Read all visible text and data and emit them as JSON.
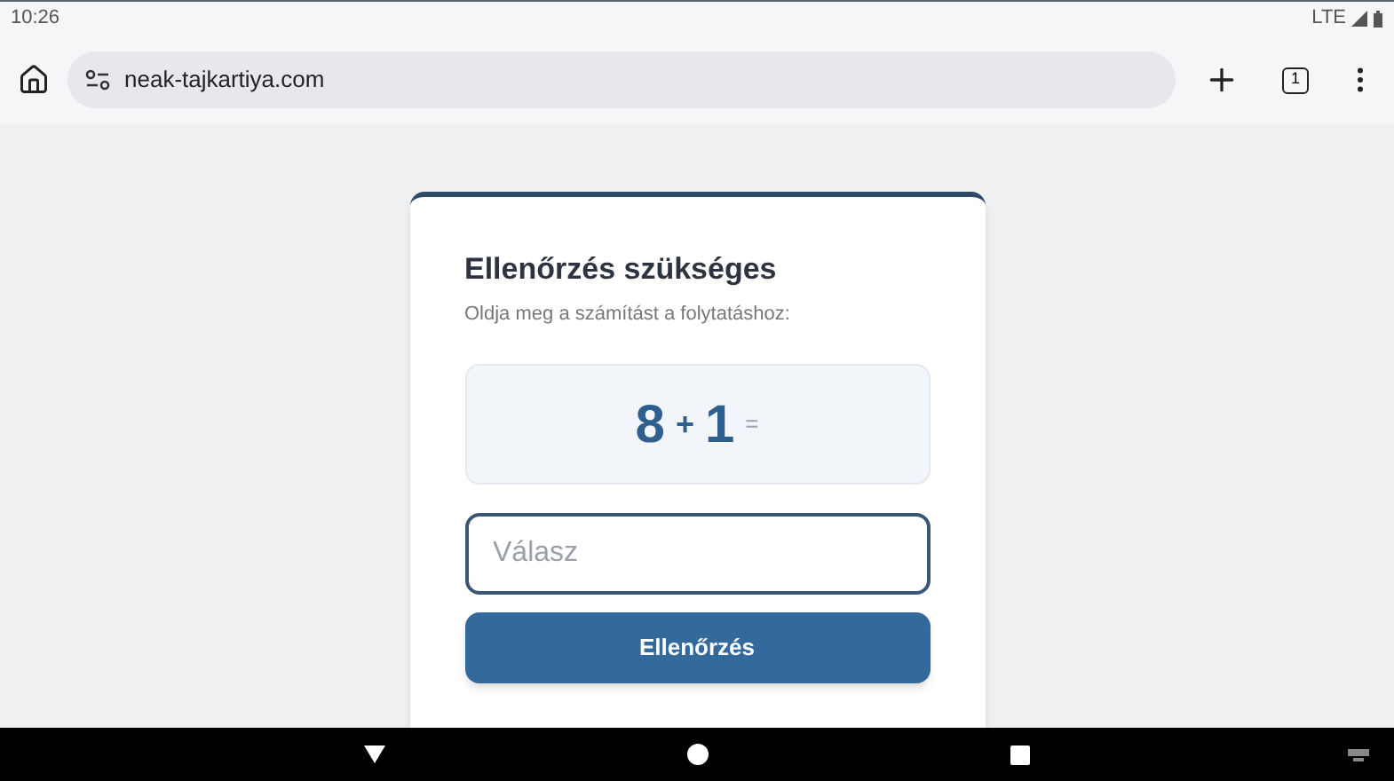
{
  "status_bar": {
    "time": "10:26",
    "network": "LTE"
  },
  "browser": {
    "url": "neak-tajkartiya.com",
    "tab_count": "1"
  },
  "card": {
    "title": "Ellenőrzés szükséges",
    "subtitle": "Oldja meg a számítást a folytatáshoz:",
    "equation": [
      {
        "kind": "number",
        "text": "8"
      },
      {
        "kind": "operator",
        "text": "+"
      },
      {
        "kind": "number",
        "text": "1"
      },
      {
        "kind": "equals",
        "text": "="
      }
    ],
    "answer": {
      "placeholder": "Válasz"
    },
    "button": "Ellenőrzés"
  }
}
